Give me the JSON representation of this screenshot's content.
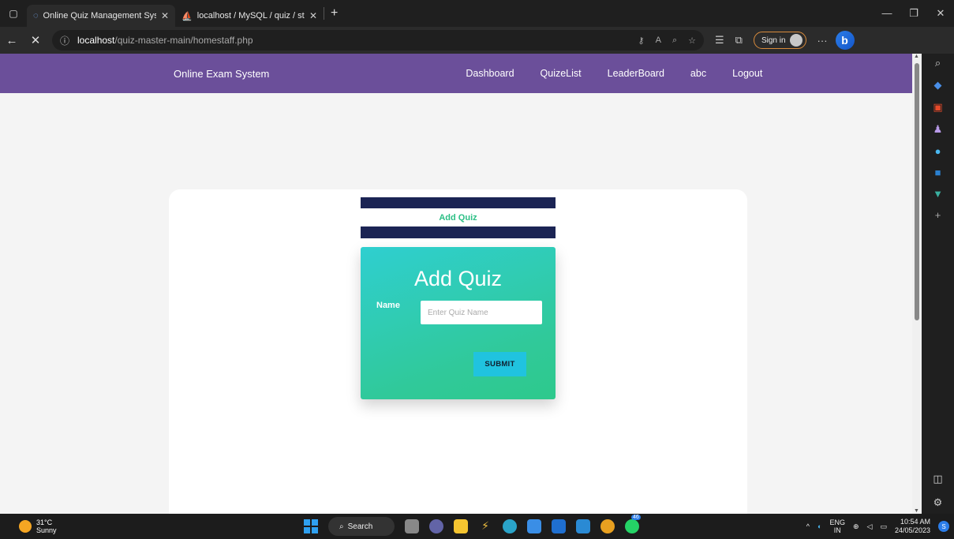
{
  "browser": {
    "tabs": [
      {
        "title": "Online Quiz Management System",
        "active": true
      },
      {
        "title": "localhost / MySQL / quiz / student",
        "active": false
      }
    ],
    "url_host": "localhost",
    "url_path": "/quiz-master-main/homestaff.php",
    "sign_in_label": "Sign in"
  },
  "site": {
    "brand": "Online Exam System",
    "nav": [
      "Dashboard",
      "QuizeList",
      "LeaderBoard",
      "abc",
      "Logout"
    ]
  },
  "panel": {
    "tab_label": "Add Quiz",
    "heading": "Add Quiz",
    "name_label": "Name",
    "name_placeholder": "Enter Quiz Name",
    "submit_label": "SUBMIT"
  },
  "taskbar": {
    "temperature": "31°C",
    "weather": "Sunny",
    "search_label": "Search",
    "whatsapp_badge": "46",
    "lang_top": "ENG",
    "lang_bottom": "IN",
    "time": "10:54 AM",
    "date": "24/05/2023"
  },
  "colors": {
    "navbar": "#6b4f9a",
    "tab_header": "#1b2454",
    "accent_green": "#2bbf85",
    "submit_button": "#20c3df"
  }
}
